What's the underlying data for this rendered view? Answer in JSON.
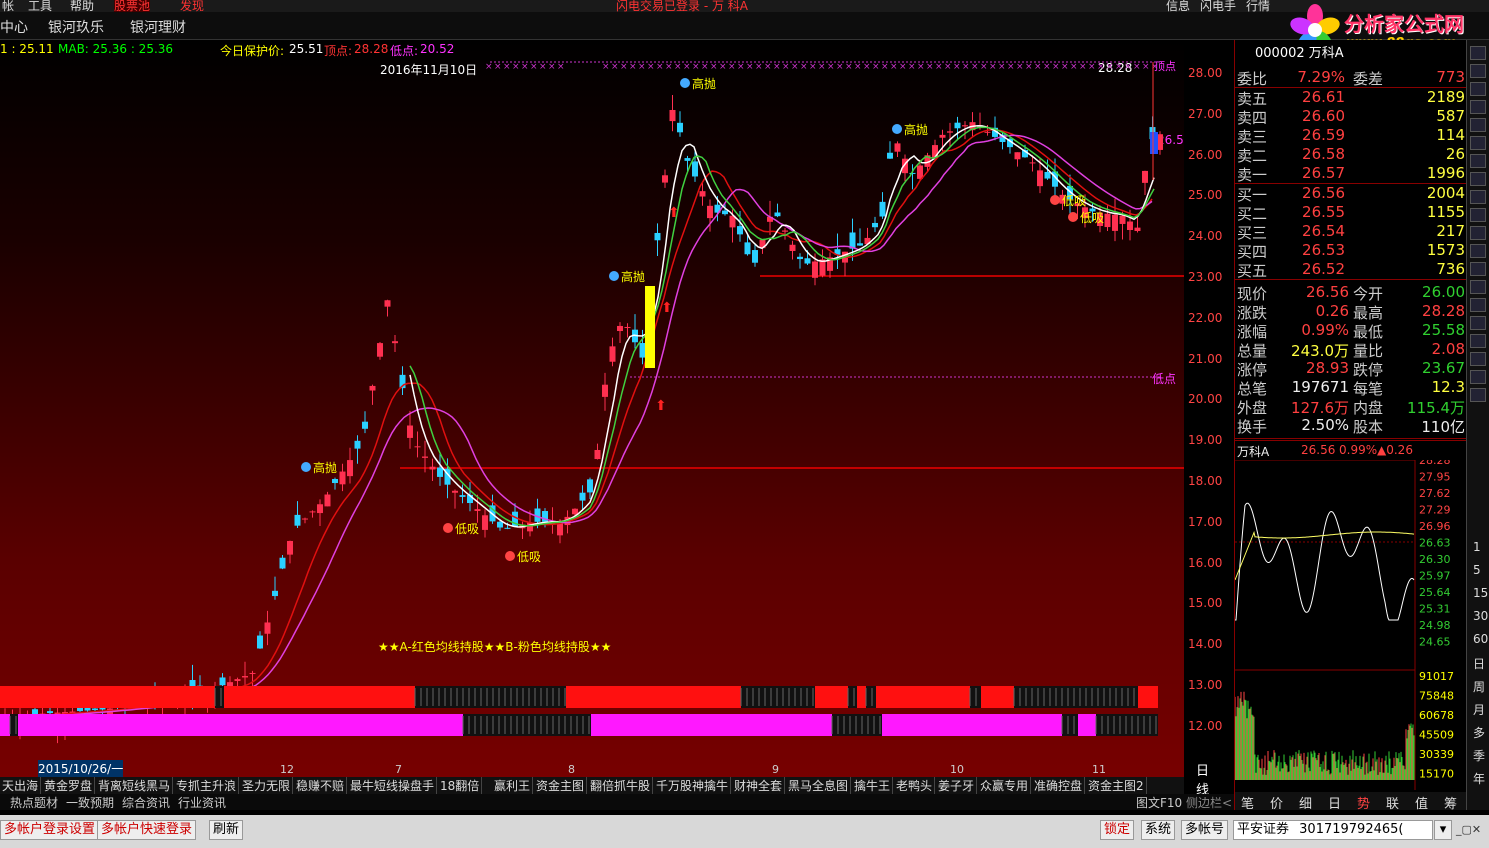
{
  "menubar": {
    "items": [
      "帐",
      "工具",
      "帮助",
      "股票池",
      "发现"
    ],
    "notice": "闪电交易已登录 - 万 科A",
    "right": [
      "信息",
      "闪电手",
      "行情"
    ]
  },
  "navbar": {
    "items": [
      "中心",
      "银河玖乐",
      "银河理财"
    ]
  },
  "logo": {
    "text": "分析家公式网",
    "url": "www.88gs.com"
  },
  "indicator": {
    "ma1": "1 : 25.11",
    "mab": "MAB: 25.36 : 25.36",
    "protect_label": "今日保护价:",
    "protect": "25.51",
    "top_label": "顶点:",
    "top": "28.28",
    "low_label": "低点:",
    "low": "20.52"
  },
  "chart_labels": {
    "date_top": "2016年11月10日",
    "price_top": "28.28",
    "top_marker": "顶点",
    "low_marker": "低点",
    "last_price": "26.56",
    "legend": "★★A-红色均线持股★★B-粉色均线持股★★",
    "date_cursor": "2015/10/26/一",
    "high_sell": "高抛",
    "low_buy": "低吸"
  },
  "chart_data": {
    "type": "candlestick",
    "title": "",
    "y_ticks": [
      "28.00",
      "27.00",
      "26.00",
      "25.00",
      "24.00",
      "23.00",
      "22.00",
      "21.00",
      "20.00",
      "19.00",
      "18.00",
      "17.00",
      "16.00",
      "15.00",
      "14.00",
      "13.00",
      "12.00"
    ],
    "x_ticks": [
      "12",
      "7",
      "8",
      "9",
      "10",
      "11"
    ],
    "ylim": [
      12,
      28.3
    ]
  },
  "quote": {
    "title": "000002 万科A",
    "webi": {
      "l": "委比",
      "v": "7.29%",
      "l2": "委差",
      "v2": "773"
    },
    "sell": [
      {
        "l": "卖五",
        "p": "26.61",
        "q": "2189"
      },
      {
        "l": "卖四",
        "p": "26.60",
        "q": "587"
      },
      {
        "l": "卖三",
        "p": "26.59",
        "q": "114"
      },
      {
        "l": "卖二",
        "p": "26.58",
        "q": "26"
      },
      {
        "l": "卖一",
        "p": "26.57",
        "q": "1996"
      }
    ],
    "buy": [
      {
        "l": "买一",
        "p": "26.56",
        "q": "2004"
      },
      {
        "l": "买二",
        "p": "26.55",
        "q": "1155"
      },
      {
        "l": "买三",
        "p": "26.54",
        "q": "217"
      },
      {
        "l": "买四",
        "p": "26.53",
        "q": "1573"
      },
      {
        "l": "买五",
        "p": "26.52",
        "q": "736"
      }
    ],
    "stats": [
      {
        "l": "现价",
        "v": "26.56",
        "c": "red",
        "l2": "今开",
        "v2": "26.00",
        "c2": "grn"
      },
      {
        "l": "涨跌",
        "v": "0.26",
        "c": "red",
        "l2": "最高",
        "v2": "28.28",
        "c2": "red"
      },
      {
        "l": "涨幅",
        "v": "0.99%",
        "c": "red",
        "l2": "最低",
        "v2": "25.58",
        "c2": "grn"
      },
      {
        "l": "总量",
        "v": "243.0万",
        "c": "yel",
        "l2": "量比",
        "v2": "2.08",
        "c2": "red"
      },
      {
        "l": "涨停",
        "v": "28.93",
        "c": "red",
        "l2": "跌停",
        "v2": "23.67",
        "c2": "grn"
      },
      {
        "l": "总笔",
        "v": "197671",
        "c": "wht",
        "l2": "每笔",
        "v2": "12.3",
        "c2": "yel"
      },
      {
        "l": "外盘",
        "v": "127.6万",
        "c": "red",
        "l2": "内盘",
        "v2": "115.4万",
        "c2": "grn"
      },
      {
        "l": "换手",
        "v": "2.50%",
        "c": "wht",
        "l2": "股本",
        "v2": "110亿",
        "c2": "wht"
      }
    ]
  },
  "mini": {
    "name": "万科A",
    "price": "26.56",
    "pct": "0.99%",
    "chg": "▲0.26",
    "prices": [
      "28.28",
      "27.95",
      "27.62",
      "27.29",
      "26.96",
      "26.63",
      "26.30",
      "25.97",
      "25.64",
      "25.31",
      "24.98",
      "24.65"
    ],
    "vols": [
      "91017",
      "75848",
      "60678",
      "45509",
      "30339",
      "15170"
    ],
    "tabs": [
      "笔",
      "价",
      "细",
      "日",
      "势",
      "联",
      "值",
      "筹"
    ]
  },
  "period": "日线",
  "bottom_tabs": [
    "天出海",
    "黄金罗盘",
    "背离短线黑马",
    "专抓主升浪",
    "圣力无限",
    "稳赚不赔",
    "最牛短线操盘手",
    "18翻倍",
    "赢利王",
    "资金主图",
    "翻倍抓牛股",
    "千万股神擒牛",
    "财神全套",
    "黑马全息图",
    "擒牛王",
    "老鸭头",
    "姜子牙",
    "众赢专用",
    "准确控盘",
    "资金主图2"
  ],
  "bottom_tabs2": [
    "热点题材",
    "一致预期",
    "综合资讯",
    "行业资讯"
  ],
  "bottom_right": [
    "图文F10",
    "侧边栏<"
  ],
  "status": {
    "b1": "多帐户登录设置",
    "b2": "多帐户快速登录",
    "b3": "刷新",
    "lock": "锁定",
    "sys": "系统",
    "multi": "多帐号",
    "broker": "平安证券",
    "account": "301719792465("
  },
  "side_icons": [
    "1",
    "5",
    "15",
    "30",
    "60",
    "日",
    "周",
    "月",
    "多",
    "季",
    "年"
  ]
}
